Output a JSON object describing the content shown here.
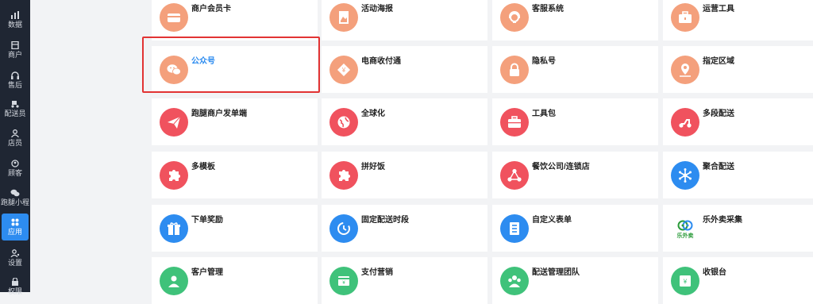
{
  "sidebar": {
    "items": [
      {
        "label": "数据",
        "icon": "chart-icon",
        "active": false
      },
      {
        "label": "商户",
        "icon": "store-icon",
        "active": false
      },
      {
        "label": "售后",
        "icon": "headset-icon",
        "active": false
      },
      {
        "label": "配送员",
        "icon": "rider-icon",
        "active": false
      },
      {
        "label": "店员",
        "icon": "clerk-icon",
        "active": false
      },
      {
        "label": "顾客",
        "icon": "customer-icon",
        "active": false
      },
      {
        "label": "跑腿小程序",
        "icon": "wechat-icon",
        "active": false
      },
      {
        "label": "应用",
        "icon": "apps-icon",
        "active": true
      },
      {
        "label": "设置",
        "icon": "settings-icon",
        "active": false
      },
      {
        "label": "权限",
        "icon": "lock-icon",
        "active": false
      }
    ]
  },
  "cards": [
    {
      "label": "商户会员卡",
      "icon": "member-card-icon",
      "color": "#f4a07c"
    },
    {
      "label": "活动海报",
      "icon": "poster-icon",
      "color": "#f4a07c"
    },
    {
      "label": "客服系统",
      "icon": "customer-service-icon",
      "color": "#f4a07c"
    },
    {
      "label": "运营工具",
      "icon": "toolbox-icon",
      "color": "#f4a07c"
    },
    {
      "label": "公众号",
      "icon": "wechat-official-icon",
      "color": "#f4a07c",
      "selected": true
    },
    {
      "label": "电商收付通",
      "icon": "payment-icon",
      "color": "#f4a07c"
    },
    {
      "label": "隐私号",
      "icon": "privacy-lock-icon",
      "color": "#f4a07c"
    },
    {
      "label": "指定区域",
      "icon": "map-pin-icon",
      "color": "#f4a07c"
    },
    {
      "label": "跑腿商户发单端",
      "icon": "paper-plane-icon",
      "color": "#f0525e"
    },
    {
      "label": "全球化",
      "icon": "globe-icon",
      "color": "#f0525e"
    },
    {
      "label": "工具包",
      "icon": "briefcase-icon",
      "color": "#f0525e"
    },
    {
      "label": "多段配送",
      "icon": "scooter-icon",
      "color": "#f0525e"
    },
    {
      "label": "多模板",
      "icon": "puzzle-icon",
      "color": "#f0525e"
    },
    {
      "label": "拼好饭",
      "icon": "puzzle-icon",
      "color": "#f0525e"
    },
    {
      "label": "餐饮公司/连锁店",
      "icon": "network-icon",
      "color": "#f0525e"
    },
    {
      "label": "聚合配送",
      "icon": "hub-icon",
      "color": "#2d8cf0"
    },
    {
      "label": "下单奖励",
      "icon": "gift-icon",
      "color": "#2d8cf0"
    },
    {
      "label": "固定配送时段",
      "icon": "clock-icon",
      "color": "#2d8cf0"
    },
    {
      "label": "自定义表单",
      "icon": "form-icon",
      "color": "#2d8cf0"
    },
    {
      "label": "乐外卖采集",
      "icon": "lewai-logo-icon",
      "color": "#ffffff",
      "logo_text": "乐外卖"
    },
    {
      "label": "客户管理",
      "icon": "users-icon",
      "color": "#3fc27a"
    },
    {
      "label": "支付营销",
      "icon": "payment-marketing-icon",
      "color": "#3fc27a"
    },
    {
      "label": "配送管理团队",
      "icon": "team-icon",
      "color": "#3fc27a"
    },
    {
      "label": "收银台",
      "icon": "cashier-icon",
      "color": "#3fc27a"
    }
  ]
}
